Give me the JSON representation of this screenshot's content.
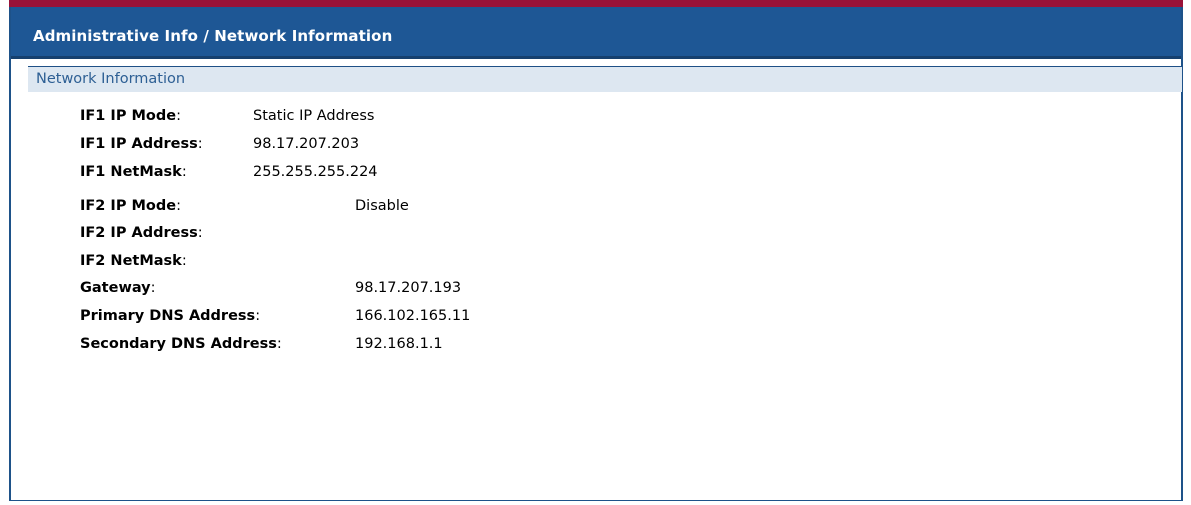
{
  "header": {
    "breadcrumb": "Administrative Info / Network Information"
  },
  "section": {
    "title": "Network Information"
  },
  "fields": [
    {
      "label": "IF1 IP Mode",
      "value": "Static IP Address"
    },
    {
      "label": "IF1 IP Address",
      "value": "98.17.207.203"
    },
    {
      "label": "IF1 NetMask",
      "value": "255.255.255.224"
    },
    {
      "label": "IF2 IP Mode",
      "value": "Disable"
    },
    {
      "label": "IF2 IP Address",
      "value": ""
    },
    {
      "label": "IF2 NetMask",
      "value": ""
    },
    {
      "label": "Gateway",
      "value": "98.17.207.193"
    },
    {
      "label": "Primary DNS Address",
      "value": "166.102.165.11"
    },
    {
      "label": "Secondary DNS Address",
      "value": "192.168.1.1"
    }
  ],
  "colors": {
    "top_stripe": "#9a1238",
    "title_bar": "#1e5795",
    "section_header_bg": "#dde7f1",
    "section_title_text": "#2d5f94"
  }
}
